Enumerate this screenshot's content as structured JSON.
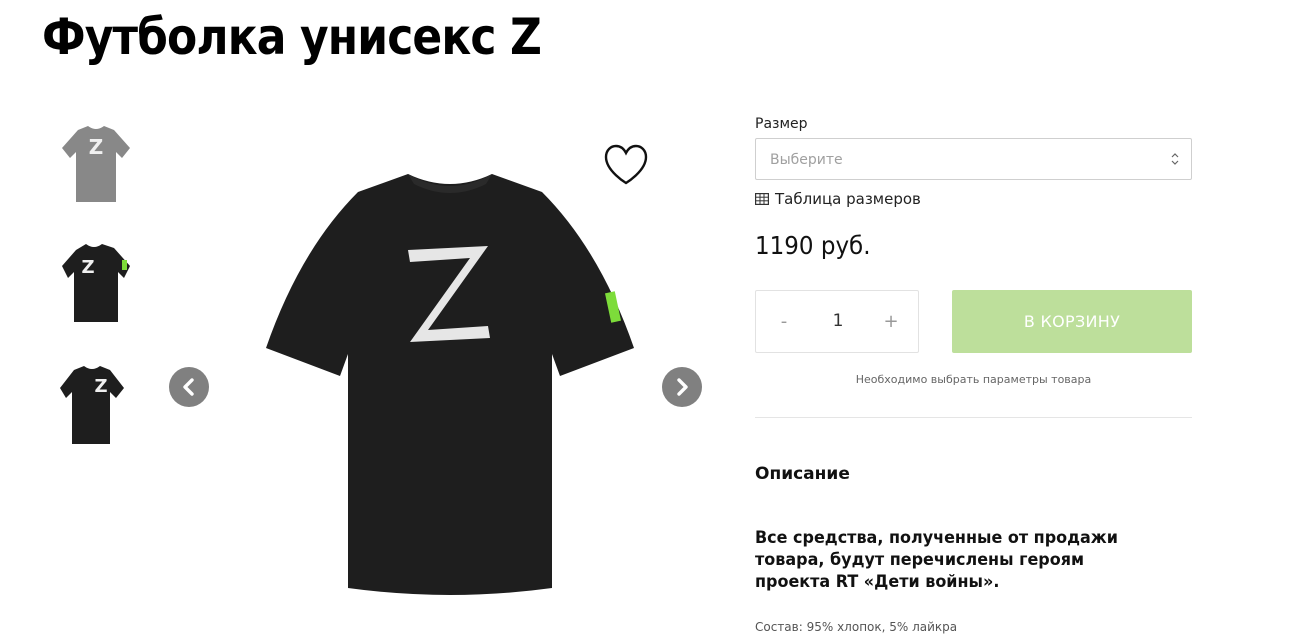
{
  "product": {
    "title": "Футболка унисекс Z",
    "price": "1190 руб."
  },
  "thumbnails": [
    {
      "color": "#888888",
      "variant": "grey-front"
    },
    {
      "color": "#1e1e1e",
      "variant": "black-side"
    },
    {
      "color": "#1e1e1e",
      "variant": "black-front"
    }
  ],
  "options": {
    "size_label": "Размер",
    "size_placeholder": "Выберите",
    "size_table_link": "Таблица размеров"
  },
  "quantity": {
    "minus": "-",
    "value": "1",
    "plus": "+"
  },
  "cart": {
    "button_label": "В КОРЗИНУ",
    "notice": "Необходимо выбрать параметры товара"
  },
  "description": {
    "title": "Описание",
    "text": "Все средства, полученные от продажи товара, будут перечислены героям проекта RT «Дети войны».",
    "composition": "Состав: 95% хлопок, 5% лайкра"
  },
  "colors": {
    "cart_button": "#bddf9b",
    "nav_button": "#808080",
    "shirt_black": "#1e1e1e",
    "shirt_grey": "#888888",
    "sleeve_tag": "#7ddc3a"
  },
  "icons": {
    "favorite": "heart-outline-icon",
    "prev": "chevron-left-icon",
    "next": "chevron-right-icon",
    "select": "chevron-updown-icon",
    "size_table": "table-grid-icon"
  }
}
